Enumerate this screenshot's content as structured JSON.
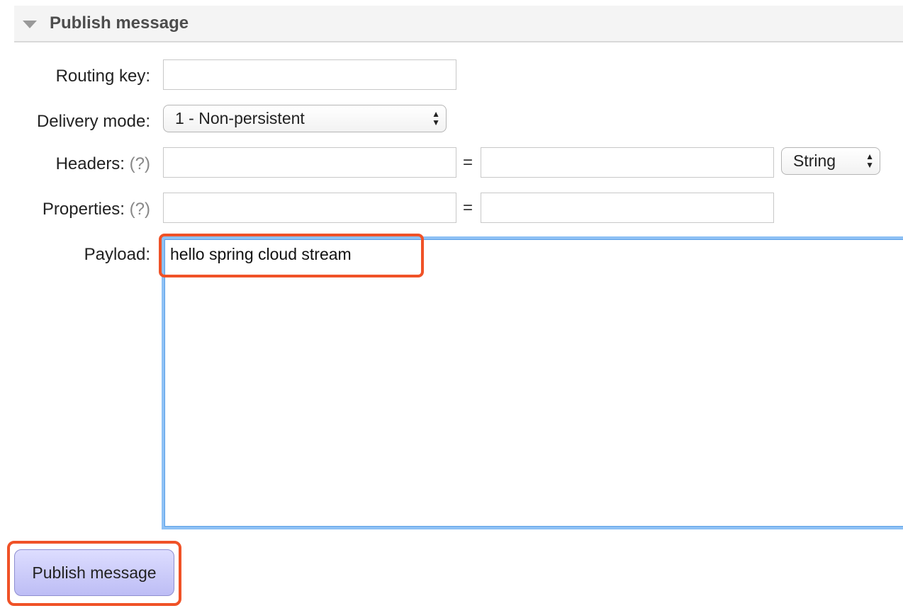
{
  "section": {
    "title": "Publish message"
  },
  "form": {
    "routing_key_label": "Routing key:",
    "routing_key_value": "",
    "delivery_mode_label": "Delivery mode:",
    "delivery_mode_value": "1 - Non-persistent",
    "headers_label": "Headers:",
    "headers_help": "(?)",
    "headers_key_value": "",
    "headers_eq": "=",
    "headers_value": "",
    "headers_type_value": "String",
    "properties_label": "Properties:",
    "properties_help": "(?)",
    "properties_key_value": "",
    "properties_eq": "=",
    "properties_value": "",
    "payload_label": "Payload:",
    "payload_value": "hello spring cloud stream"
  },
  "actions": {
    "publish_label": "Publish message"
  },
  "colors": {
    "highlight": "#f05227",
    "focus_border": "#8ec1f5",
    "button_bg": "#c8c8f8"
  }
}
